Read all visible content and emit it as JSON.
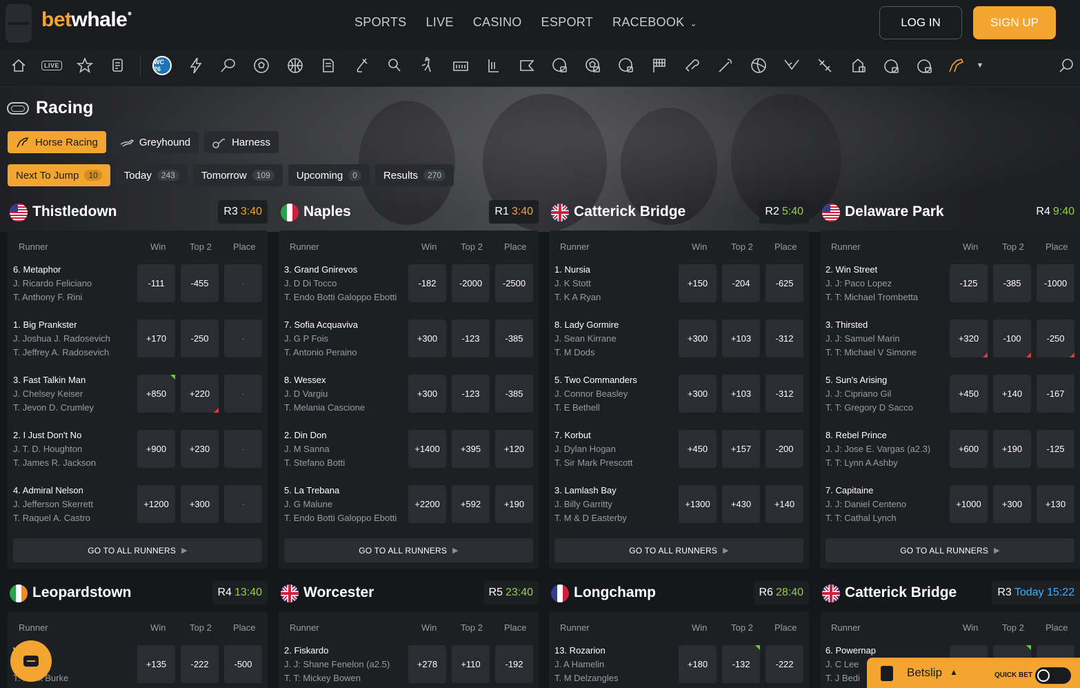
{
  "brand": {
    "part1": "bet",
    "part2": "whale"
  },
  "nav": {
    "items": [
      "SPORTS",
      "LIVE",
      "CASINO",
      "ESPORT",
      "RACEBOOK"
    ],
    "login": "LOG IN",
    "signup": "SIGN UP"
  },
  "iconbar": {
    "live_label": "LIVE",
    "wc_label": "WC 26",
    "icons": [
      "home-icon",
      "live-icon",
      "favorites-icon",
      "betslip-icon",
      "world-cup-icon",
      "lightning-icon",
      "tennis-icon",
      "soccer-icon",
      "basketball-icon",
      "baseball-icon",
      "hockey-icon",
      "table-tennis-icon",
      "cricket-icon",
      "mma-icon",
      "nfl-icon",
      "nba2k-icon",
      "fifa-icon",
      "efootball-icon",
      "esport-icon",
      "motorsport-icon",
      "boxing-icon",
      "golf-icon",
      "volleyball-icon",
      "volta-icon",
      "darts-icon",
      "virtual-icon",
      "volta-football-icon",
      "penalty-icon",
      "horse-racing-icon",
      "search-icon"
    ]
  },
  "page": {
    "title": "Racing"
  },
  "sport_tabs": [
    {
      "label": "Horse Racing",
      "active": true
    },
    {
      "label": "Greyhound",
      "active": false
    },
    {
      "label": "Harness",
      "active": false
    }
  ],
  "filter_tabs": [
    {
      "label": "Next To Jump",
      "count": "10",
      "active": true
    },
    {
      "label": "Today",
      "count": "243",
      "active": false
    },
    {
      "label": "Tomorrow",
      "count": "109",
      "active": false
    },
    {
      "label": "Upcoming",
      "count": "0",
      "active": false
    },
    {
      "label": "Results",
      "count": "270",
      "active": false
    }
  ],
  "columns": {
    "runner": "Runner",
    "win": "Win",
    "top2": "Top 2",
    "place": "Place"
  },
  "go_all": "GO TO ALL RUNNERS",
  "races": [
    {
      "track": "Thistledown",
      "flag": "us",
      "race": "R3",
      "time": "3:40",
      "time_color": "orange",
      "runners": [
        {
          "name": "6. Metaphor",
          "jockey": "J. Ricardo Feliciano",
          "trainer": "T. Anthony F. Rini",
          "win": "-111",
          "top2": "-455",
          "place": "-"
        },
        {
          "name": "1. Big Prankster",
          "jockey": "J. Joshua J. Radosevich",
          "trainer": "T. Jeffrey A. Radosevich",
          "win": "+170",
          "top2": "-250",
          "place": "-"
        },
        {
          "name": "3. Fast Talkin Man",
          "jockey": "J. Chelsey Keiser",
          "trainer": "T. Jevon D. Crumley",
          "win": "+850",
          "top2": "+220",
          "place": "-"
        },
        {
          "name": "2. I Just Don't No",
          "jockey": "J. T. D. Houghton",
          "trainer": "T. James R. Jackson",
          "win": "+900",
          "top2": "+230",
          "place": "-"
        },
        {
          "name": "4. Admiral Nelson",
          "jockey": "J. Jefferson Skerrett",
          "trainer": "T. Raquel A. Castro",
          "win": "+1200",
          "top2": "+300",
          "place": "-"
        }
      ]
    },
    {
      "track": "Naples",
      "flag": "it",
      "race": "R1",
      "time": "3:40",
      "time_color": "orange",
      "runners": [
        {
          "name": "3. Grand Gnirevos",
          "jockey": "J. D Di Tocco",
          "trainer": "T. Endo Botti Galoppo Ebotti",
          "win": "-182",
          "top2": "-2000",
          "place": "-2500"
        },
        {
          "name": "7. Sofia Acquaviva",
          "jockey": "J. G P Fois",
          "trainer": "T. Antonio Peraino",
          "win": "+300",
          "top2": "-123",
          "place": "-385"
        },
        {
          "name": "8. Wessex",
          "jockey": "J. D Vargiu",
          "trainer": "T. Melania Cascione",
          "win": "+300",
          "top2": "-123",
          "place": "-385"
        },
        {
          "name": "2. Din Don",
          "jockey": "J. M Sanna",
          "trainer": "T. Stefano Botti",
          "win": "+1400",
          "top2": "+395",
          "place": "+120"
        },
        {
          "name": "5. La Trebana",
          "jockey": "J. G Malune",
          "trainer": "T. Endo Botti Galoppo Ebotti",
          "win": "+2200",
          "top2": "+592",
          "place": "+190"
        }
      ]
    },
    {
      "track": "Catterick Bridge",
      "flag": "uk",
      "race": "R2",
      "time": "5:40",
      "time_color": "green",
      "runners": [
        {
          "name": "1. Nursia",
          "jockey": "J. K Stott",
          "trainer": "T. K A Ryan",
          "win": "+150",
          "top2": "-204",
          "place": "-625"
        },
        {
          "name": "8. Lady Gormire",
          "jockey": "J. Sean Kirrane",
          "trainer": "T. M Dods",
          "win": "+300",
          "top2": "+103",
          "place": "-312"
        },
        {
          "name": "5. Two Commanders",
          "jockey": "J. Connor Beasley",
          "trainer": "T. E Bethell",
          "win": "+300",
          "top2": "+103",
          "place": "-312"
        },
        {
          "name": "7. Korbut",
          "jockey": "J. Dylan Hogan",
          "trainer": "T. Sir Mark Prescott",
          "win": "+450",
          "top2": "+157",
          "place": "-200"
        },
        {
          "name": "3. Lamlash Bay",
          "jockey": "J. Billy Garritty",
          "trainer": "T. M & D Easterby",
          "win": "+1300",
          "top2": "+430",
          "place": "+140"
        }
      ]
    },
    {
      "track": "Delaware Park",
      "flag": "us",
      "race": "R4",
      "time": "9:40",
      "time_color": "green",
      "runners": [
        {
          "name": "2. Win Street",
          "jockey": "J. J: Paco Lopez",
          "trainer": "T. T: Michael Trombetta",
          "win": "-125",
          "top2": "-385",
          "place": "-1000"
        },
        {
          "name": "3. Thirsted",
          "jockey": "J. J: Samuel Marin",
          "trainer": "T. T: Michael V Simone",
          "win": "+320",
          "top2": "-100",
          "place": "-250"
        },
        {
          "name": "5. Sun's Arising",
          "jockey": "J. J: Cipriano Gil",
          "trainer": "T. T: Gregory D Sacco",
          "win": "+450",
          "top2": "+140",
          "place": "-167"
        },
        {
          "name": "8. Rebel Prince",
          "jockey": "J. J: Jose E. Vargas (a2.3)",
          "trainer": "T. T: Lynn A Ashby",
          "win": "+600",
          "top2": "+190",
          "place": "-125"
        },
        {
          "name": "7. Capitaine",
          "jockey": "J. J: Daniel Centeno",
          "trainer": "T. T: Cathal Lynch",
          "win": "+1000",
          "top2": "+300",
          "place": "+130"
        }
      ]
    },
    {
      "track": "Leopardstown",
      "flag": "ie",
      "race": "R4",
      "time": "13:40",
      "time_color": "green",
      "runners": [
        {
          "name": "Warrior",
          "jockey": "Doyle",
          "trainer": "T. Mark Burke",
          "win": "+135",
          "top2": "-222",
          "place": "-500"
        }
      ]
    },
    {
      "track": "Worcester",
      "flag": "uk",
      "race": "R5",
      "time": "23:40",
      "time_color": "green",
      "runners": [
        {
          "name": "2. Fiskardo",
          "jockey": "J. J: Shane Fenelon (a2.5)",
          "trainer": "T. T: Mickey Bowen",
          "win": "+278",
          "top2": "+110",
          "place": "-192"
        }
      ]
    },
    {
      "track": "Longchamp",
      "flag": "fr",
      "race": "R6",
      "time": "28:40",
      "time_color": "green",
      "runners": [
        {
          "name": "13. Rozarion",
          "jockey": "J. A Hamelin",
          "trainer": "T. M Delzangles",
          "win": "+180",
          "top2": "-132",
          "place": "-222"
        }
      ]
    },
    {
      "track": "Catterick Bridge",
      "flag": "uk",
      "race": "R3",
      "time": "Today 15:22",
      "time_color": "blue",
      "runners": [
        {
          "name": "6. Powernap",
          "jockey": "J. C Lee",
          "trainer": "T. J Bedi",
          "win": "",
          "top2": "",
          "place": ""
        }
      ]
    }
  ],
  "betslip": {
    "label": "Betslip",
    "quick_bet": "QUICK BET"
  }
}
